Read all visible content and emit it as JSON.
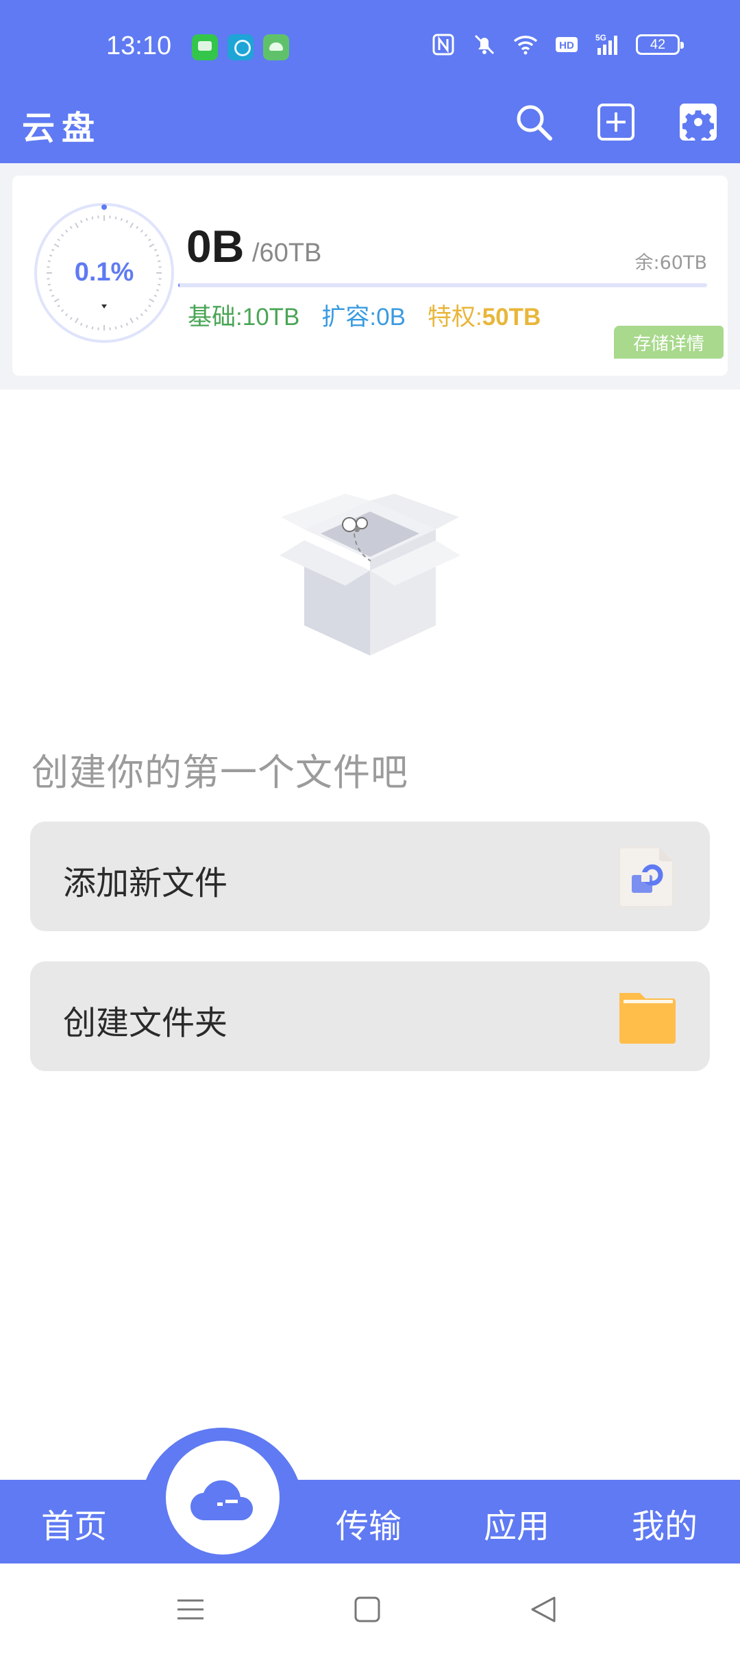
{
  "status_bar": {
    "time": "13:10",
    "battery": "42"
  },
  "header": {
    "title": "云盘"
  },
  "storage": {
    "percent_text": "0.1%",
    "usage_fraction": 0.001,
    "used": "0B",
    "total": "/60TB",
    "remaining": "余:60TB",
    "base_label": "基础:",
    "base_value": "10TB",
    "expand_label": "扩容:",
    "expand_value": "0B",
    "privilege_label": "特权:",
    "privilege_value": "50TB",
    "detail_button": "存储详情"
  },
  "empty_state": {
    "title": "创建你的第一个文件吧",
    "actions": [
      {
        "label": "添加新文件"
      },
      {
        "label": "创建文件夹"
      }
    ]
  },
  "bottom_nav": {
    "items": [
      {
        "label": "首页"
      },
      {
        "label": "传输"
      },
      {
        "label": "应用"
      },
      {
        "label": "我的"
      }
    ]
  },
  "colors": {
    "primary": "#5f7af2",
    "base_green": "#4aa556",
    "expand_blue": "#3a9be0",
    "privilege_yellow": "#e8b63a",
    "detail_button_bg": "#a8d98c",
    "folder_orange": "#ffbd4a"
  }
}
